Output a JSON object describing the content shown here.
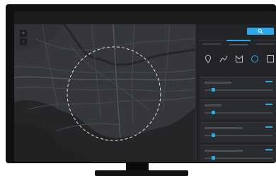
{
  "window": {
    "title": ""
  },
  "map": {
    "zoom_in_label": "+",
    "zoom_out_label": "-",
    "land_color": "#35373a",
    "water_color": "#232527",
    "road_color": "#4c4f53",
    "selection_color": "#e8e8e8"
  },
  "panel": {
    "search_icon": "search-icon",
    "tabs": [
      {
        "label": "",
        "active": false
      },
      {
        "label": "",
        "active": true
      },
      {
        "label": "",
        "active": false
      }
    ],
    "tools": [
      {
        "icon": "marker-icon"
      },
      {
        "icon": "freehand-line-icon"
      },
      {
        "icon": "polygon-icon"
      },
      {
        "icon": "circle-icon",
        "active": true
      },
      {
        "icon": "rectangle-icon"
      }
    ],
    "sections": [
      {
        "label": "",
        "slider_value": 0.12
      },
      {
        "label": "",
        "slider_value": 0.12
      },
      {
        "label": "",
        "slider_value": 0.12
      },
      {
        "label": "",
        "slider_value": 0.12
      }
    ]
  },
  "accent_color": "#2ea7e8"
}
